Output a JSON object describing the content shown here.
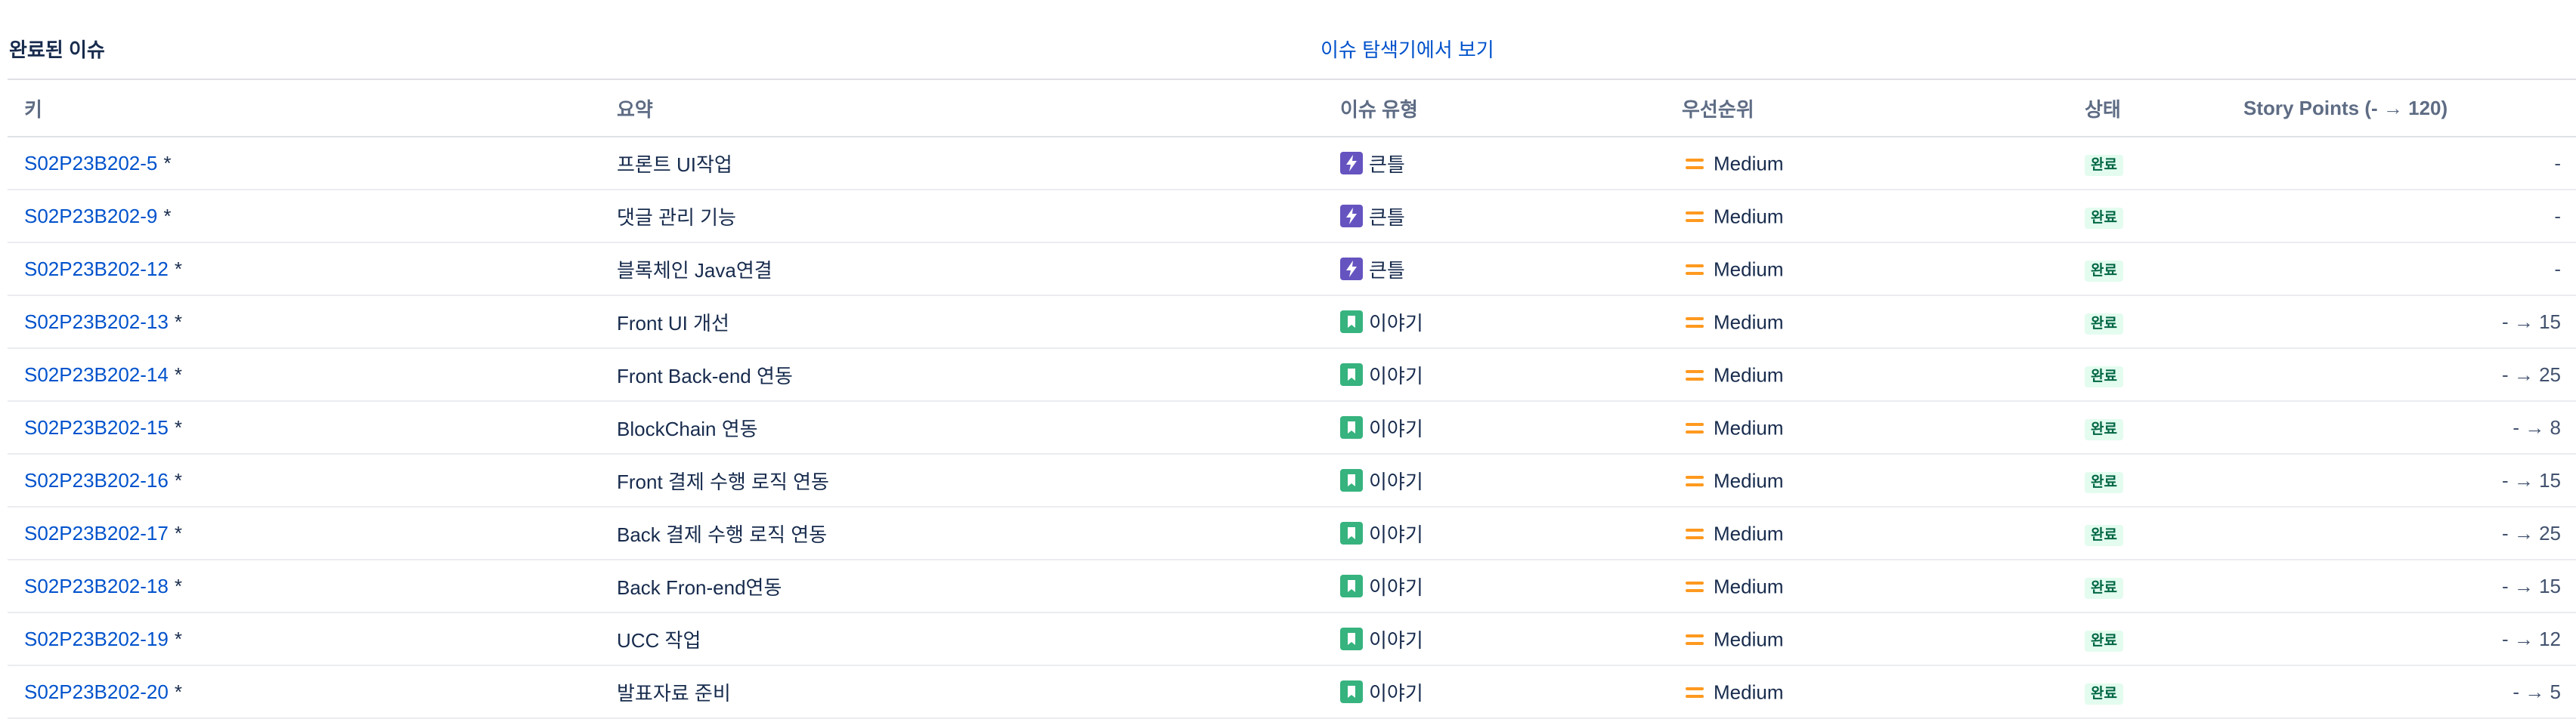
{
  "section": {
    "title": "완료된 이슈",
    "explorer_link": "이슈 탐색기에서 보기"
  },
  "columns": {
    "key": "키",
    "summary": "요약",
    "type": "이슈 유형",
    "priority": "우선순위",
    "status": "상태",
    "story_points": "Story Points (- → 120)"
  },
  "colors": {
    "epic": "#6554c0",
    "story": "#36b37e",
    "medium_priority": "#ff991f",
    "status_done_bg": "#e3fcef",
    "status_done_text": "#006644",
    "link": "#0052cc"
  },
  "issues": [
    {
      "key": "S02P23B202-5",
      "changed_mark": "*",
      "summary": "프론트 UI작업",
      "type": "큰틀",
      "type_icon": "epic-lightning-icon",
      "priority": "Medium",
      "status": "완료",
      "sp_old": "-",
      "sp_arrow": "",
      "sp_new": ""
    },
    {
      "key": "S02P23B202-9",
      "changed_mark": "*",
      "summary": "댓글 관리 기능",
      "type": "큰틀",
      "type_icon": "epic-lightning-icon",
      "priority": "Medium",
      "status": "완료",
      "sp_old": "-",
      "sp_arrow": "",
      "sp_new": ""
    },
    {
      "key": "S02P23B202-12",
      "changed_mark": "*",
      "summary": "블록체인 Java연결",
      "type": "큰틀",
      "type_icon": "epic-lightning-icon",
      "priority": "Medium",
      "status": "완료",
      "sp_old": "-",
      "sp_arrow": "",
      "sp_new": ""
    },
    {
      "key": "S02P23B202-13",
      "changed_mark": "*",
      "summary": "Front UI 개선",
      "type": "이야기",
      "type_icon": "story-bookmark-icon",
      "priority": "Medium",
      "status": "완료",
      "sp_old": "-",
      "sp_arrow": "→",
      "sp_new": "15"
    },
    {
      "key": "S02P23B202-14",
      "changed_mark": "*",
      "summary": "Front Back-end 연동",
      "type": "이야기",
      "type_icon": "story-bookmark-icon",
      "priority": "Medium",
      "status": "완료",
      "sp_old": "-",
      "sp_arrow": "→",
      "sp_new": "25"
    },
    {
      "key": "S02P23B202-15",
      "changed_mark": "*",
      "summary": "BlockChain 연동",
      "type": "이야기",
      "type_icon": "story-bookmark-icon",
      "priority": "Medium",
      "status": "완료",
      "sp_old": "-",
      "sp_arrow": "→",
      "sp_new": "8"
    },
    {
      "key": "S02P23B202-16",
      "changed_mark": "*",
      "summary": "Front 결제 수행 로직 연동",
      "type": "이야기",
      "type_icon": "story-bookmark-icon",
      "priority": "Medium",
      "status": "완료",
      "sp_old": "-",
      "sp_arrow": "→",
      "sp_new": "15"
    },
    {
      "key": "S02P23B202-17",
      "changed_mark": "*",
      "summary": "Back 결제 수행 로직 연동",
      "type": "이야기",
      "type_icon": "story-bookmark-icon",
      "priority": "Medium",
      "status": "완료",
      "sp_old": "-",
      "sp_arrow": "→",
      "sp_new": "25"
    },
    {
      "key": "S02P23B202-18",
      "changed_mark": "*",
      "summary": "Back Fron-end연동",
      "type": "이야기",
      "type_icon": "story-bookmark-icon",
      "priority": "Medium",
      "status": "완료",
      "sp_old": "-",
      "sp_arrow": "→",
      "sp_new": "15"
    },
    {
      "key": "S02P23B202-19",
      "changed_mark": "*",
      "summary": "UCC 작업",
      "type": "이야기",
      "type_icon": "story-bookmark-icon",
      "priority": "Medium",
      "status": "완료",
      "sp_old": "-",
      "sp_arrow": "→",
      "sp_new": "12"
    },
    {
      "key": "S02P23B202-20",
      "changed_mark": "*",
      "summary": "발표자료 준비",
      "type": "이야기",
      "type_icon": "story-bookmark-icon",
      "priority": "Medium",
      "status": "완료",
      "sp_old": "-",
      "sp_arrow": "→",
      "sp_new": "5"
    }
  ]
}
